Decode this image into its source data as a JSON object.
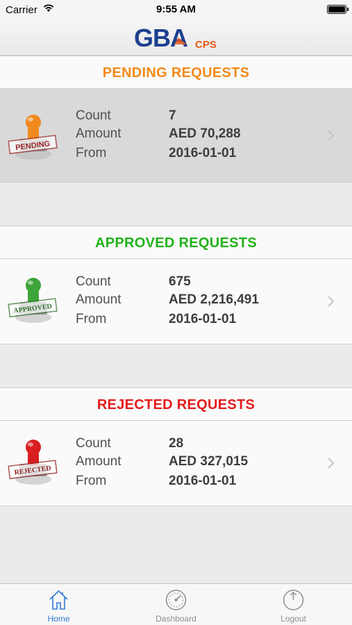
{
  "status_bar": {
    "carrier": "Carrier",
    "time": "9:55 AM"
  },
  "header": {
    "logo_text": "GBA",
    "logo_suffix": "CPS"
  },
  "sections": [
    {
      "title": "PENDING REQUESTS",
      "title_color": "#f28a1a",
      "stamp_color": "#f08a1e",
      "stamp_text": "PENDING",
      "selected": true,
      "rows": [
        {
          "label": "Count",
          "value": "7"
        },
        {
          "label": "Amount",
          "value": "AED 70,288"
        },
        {
          "label": "From",
          "value": "2016-01-01"
        }
      ]
    },
    {
      "title": "APPROVED REQUESTS",
      "title_color": "#22b21b",
      "stamp_color": "#3fa43a",
      "stamp_text": "APPROVED",
      "selected": false,
      "rows": [
        {
          "label": "Count",
          "value": "675"
        },
        {
          "label": "Amount",
          "value": "AED 2,216,491"
        },
        {
          "label": "From",
          "value": "2016-01-01"
        }
      ]
    },
    {
      "title": "REJECTED REQUESTS",
      "title_color": "#e31b1b",
      "stamp_color": "#d81e1e",
      "stamp_text": "REJECTED",
      "selected": false,
      "rows": [
        {
          "label": "Count",
          "value": "28"
        },
        {
          "label": "Amount",
          "value": "AED 327,015"
        },
        {
          "label": "From",
          "value": "2016-01-01"
        }
      ]
    }
  ],
  "tab_bar": {
    "active_color": "#2f7bd6",
    "tabs": [
      {
        "label": "Home",
        "icon": "home-icon",
        "active": true
      },
      {
        "label": "Dashboard",
        "icon": "speedometer-icon",
        "active": false
      },
      {
        "label": "Logout",
        "icon": "power-icon",
        "active": false
      }
    ]
  }
}
